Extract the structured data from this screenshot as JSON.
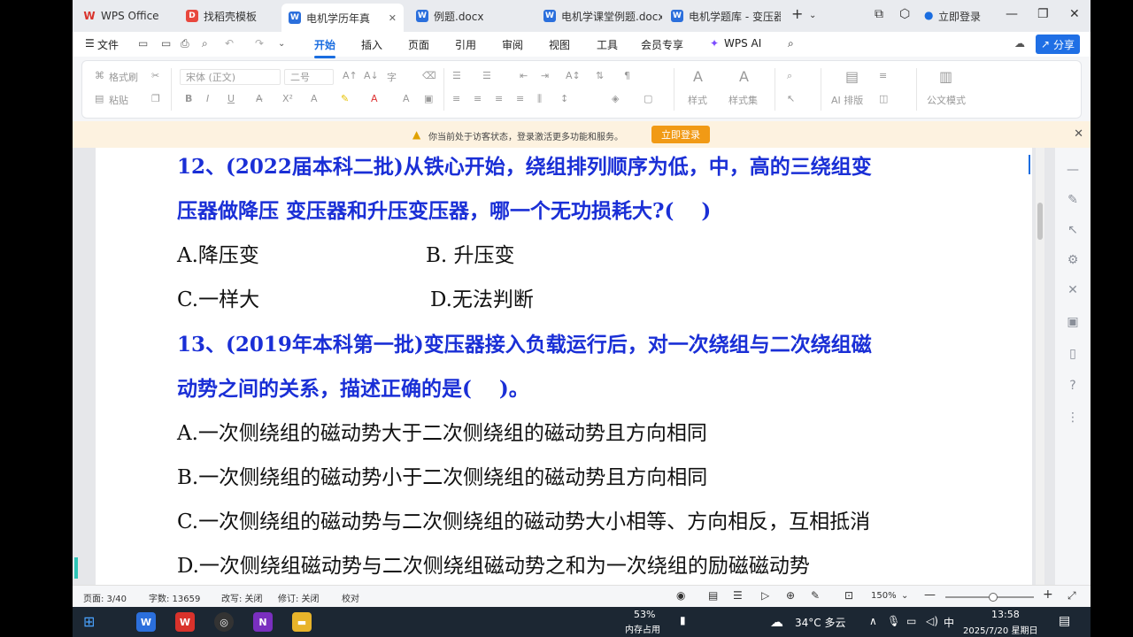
{
  "tabs": [
    {
      "label": "WPS Office",
      "color": "#d9322b",
      "glyph": "W"
    },
    {
      "label": "找稻壳模板",
      "color": "#e8473d",
      "glyph": "D"
    },
    {
      "label": "电机学历年真",
      "color": "#2b6fdc",
      "glyph": "W"
    },
    {
      "label": "例题.docx",
      "color": "#2b6fdc",
      "glyph": "W"
    },
    {
      "label": "电机学课堂例题.docx",
      "color": "#2b6fdc",
      "glyph": "W"
    },
    {
      "label": "电机学题库 - 变压器",
      "color": "#2b6fdc",
      "glyph": "W"
    }
  ],
  "header": {
    "login": "立即登录",
    "new_tab": "+",
    "share": "分享"
  },
  "menus": [
    "文件",
    "开始",
    "插入",
    "页面",
    "引用",
    "审阅",
    "视图",
    "工具",
    "会员专享",
    "WPS AI"
  ],
  "ribbon": {
    "format_brush": "格式刷",
    "paste": "粘贴",
    "font": "宋体 (正文)",
    "size": "二号",
    "styles": "样式",
    "style_set": "样式集",
    "ai_layout": "AI 排版",
    "doc_mode": "公文模式"
  },
  "notice": {
    "text": "你当前处于访客状态，登录激活更多功能和服务。",
    "button": "立即登录"
  },
  "document": {
    "q12_line1": "12、(2022届本科二批)从铁心开始，绕组排列顺序为低，中，高的三绕组变",
    "q12_line2": "压器做降压 变压器和升压变压器，哪一个无功损耗大?(　 )",
    "q12_a": "A.降压变",
    "q12_b": "B.  升压变",
    "q12_c": "C.一样大",
    "q12_d": "D.无法判断",
    "q13_line1": "13、(2019年本科第一批)变压器接入负载运行后，对一次绕组与二次绕组磁",
    "q13_line2": "动势之间的关系，描述正确的是(　 )。",
    "q13_a": "A.一次侧绕组的磁动势大于二次侧绕组的磁动势且方向相同",
    "q13_b": "B.一次侧绕组的磁动势小于二次侧绕组的磁动势且方向相同",
    "q13_c": "C.一次侧绕组的磁动势与二次侧绕组的磁动势大小相等、方向相反，互相抵消",
    "q13_d": "D.一次侧绕组磁动势与二次侧绕组磁动势之和为一次绕组的励磁磁动势"
  },
  "status": {
    "page": "页面: 3/40",
    "words": "字数: 13659",
    "rewrite": "改写: 关闭",
    "revision": "修订: 关闭",
    "proof": "校对",
    "zoom": "150%"
  },
  "taskbar": {
    "mem_pct": "53%",
    "mem_label": "内存占用",
    "weather": "34°C  多云",
    "ime": "中",
    "time": "13:58",
    "date": "2025/7/20 星期日"
  }
}
